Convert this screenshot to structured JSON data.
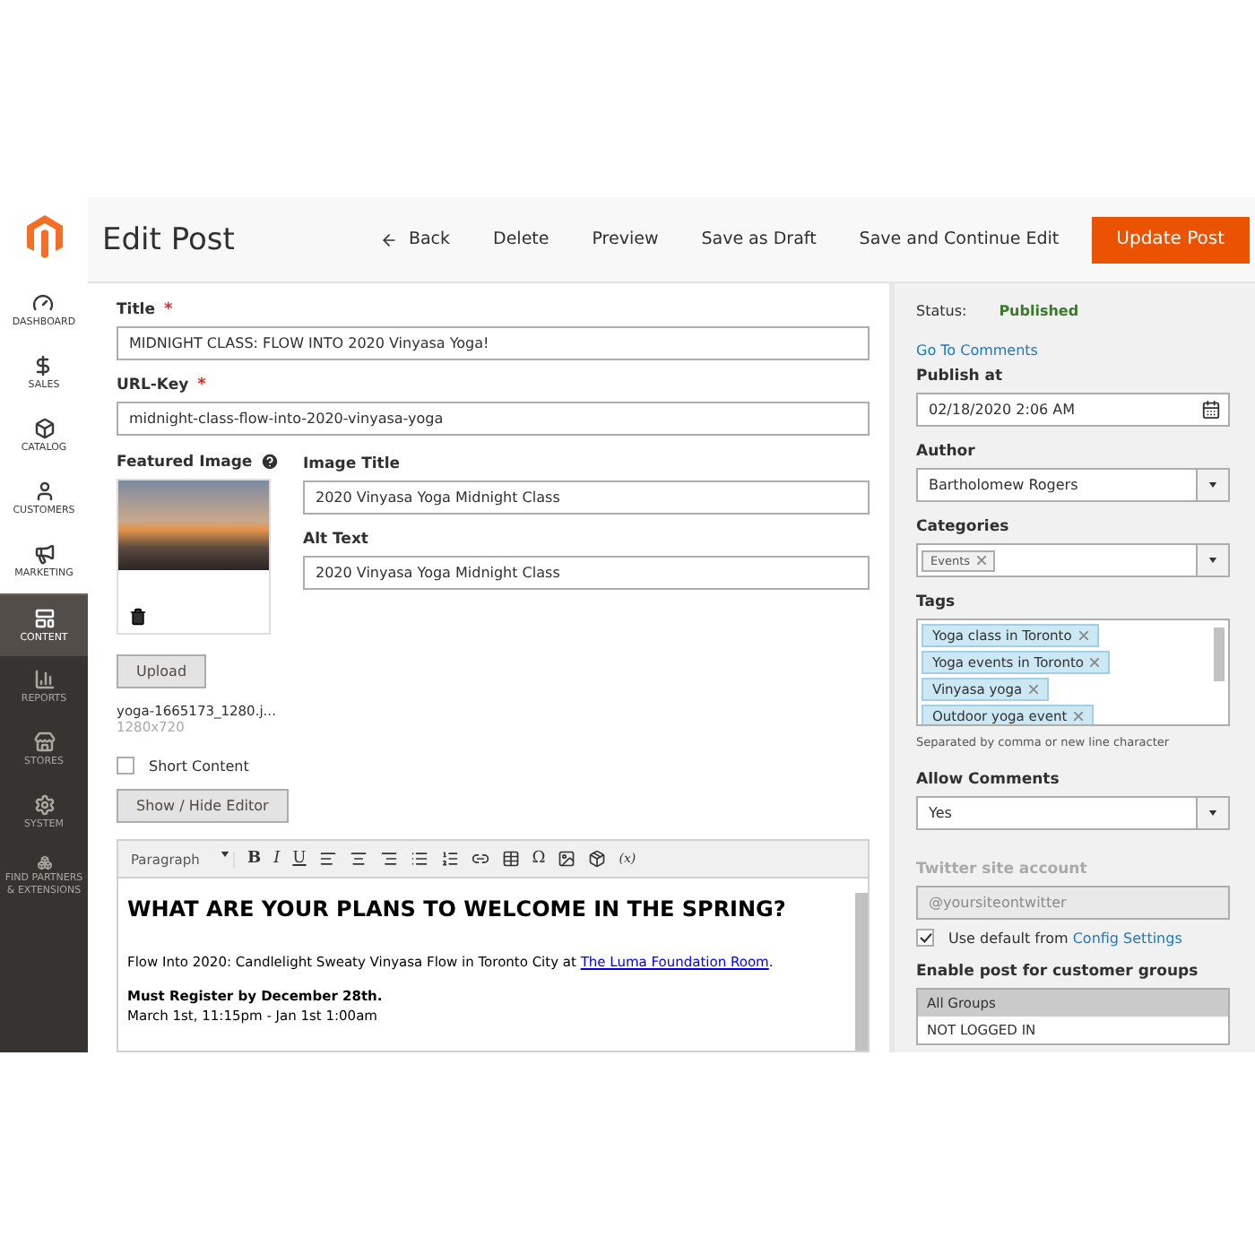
{
  "sidebar": {
    "items": [
      {
        "label": "DASHBOARD",
        "kind": "light",
        "selected": false
      },
      {
        "label": "SALES",
        "kind": "light",
        "selected": false
      },
      {
        "label": "CATALOG",
        "kind": "light",
        "selected": false
      },
      {
        "label": "CUSTOMERS",
        "kind": "light",
        "selected": false
      },
      {
        "label": "MARKETING",
        "kind": "light",
        "selected": false
      },
      {
        "label": "CONTENT",
        "kind": "dark",
        "selected": true
      },
      {
        "label": "REPORTS",
        "kind": "dark",
        "selected": false
      },
      {
        "label": "STORES",
        "kind": "dark",
        "selected": false
      },
      {
        "label": "SYSTEM",
        "kind": "dark",
        "selected": false
      },
      {
        "label": "FIND PARTNERS & EXTENSIONS",
        "kind": "dark",
        "selected": false
      }
    ]
  },
  "header": {
    "title": "Edit Post",
    "back": "Back",
    "actions": [
      "Delete",
      "Preview",
      "Save as Draft",
      "Save and Continue Edit"
    ],
    "primary": "Update Post"
  },
  "form": {
    "required_mark": "*",
    "title": {
      "label": "Title",
      "value": "MIDNIGHT CLASS: FLOW INTO 2020 Vinyasa Yoga!"
    },
    "url_key": {
      "label": "URL-Key",
      "value": "midnight-class-flow-into-2020-vinyasa-yoga"
    },
    "featured_image": {
      "label": "Featured Image",
      "upload": "Upload",
      "file_name": "yoga-1665173_1280.j...",
      "dimensions": "1280x720"
    },
    "image_title": {
      "label": "Image Title",
      "value": "2020 Vinyasa Yoga Midnight Class"
    },
    "alt_text": {
      "label": "Alt Text",
      "value": "2020 Vinyasa Yoga Midnight Class"
    },
    "short_content": {
      "label": "Short Content",
      "checked": false
    },
    "toggle_editor": "Show / Hide Editor",
    "toolbar": {
      "format": "Paragraph",
      "bold": "B",
      "italic": "I",
      "underline": "U",
      "special_char": "Ω",
      "variable": "(x)"
    },
    "editor": {
      "heading": "WHAT ARE YOUR PLANS TO WELCOME IN THE SPRING?",
      "paragraph": "Flow Into 2020: Candlelight Sweaty Vinyasa Flow in Toronto City at ",
      "link": "The Luma Foundation Room",
      "paragraph_end": ".",
      "bold_line": "Must Register by December 28th.",
      "line": "March 1st, 11:15pm - Jan 1st 1:00am"
    }
  },
  "side": {
    "status_label": "Status:",
    "status": "Published",
    "comments_link": "Go To Comments",
    "publish_at": {
      "label": "Publish at",
      "value": "02/18/2020 2:06 AM"
    },
    "author": {
      "label": "Author",
      "value": "Bartholomew Rogers"
    },
    "categories": {
      "label": "Categories",
      "chips": [
        "Events"
      ]
    },
    "tags": {
      "label": "Tags",
      "items": [
        "Yoga class in Toronto",
        "Yoga events in Toronto",
        "Vinyasa yoga",
        "Outdoor yoga event"
      ],
      "hint": "Separated by comma or new line character"
    },
    "allow_comments": {
      "label": "Allow Comments",
      "value": "Yes"
    },
    "twitter": {
      "label": "Twitter site account",
      "placeholder": "@yoursiteontwitter",
      "disabled": true
    },
    "use_default": {
      "label": "Use default from ",
      "link": "Config Settings",
      "checked": true
    },
    "customer_groups": {
      "label": "Enable post for customer groups",
      "options": [
        {
          "label": "All Groups",
          "selected": true
        },
        {
          "label": "NOT LOGGED IN",
          "selected": false
        }
      ]
    }
  }
}
